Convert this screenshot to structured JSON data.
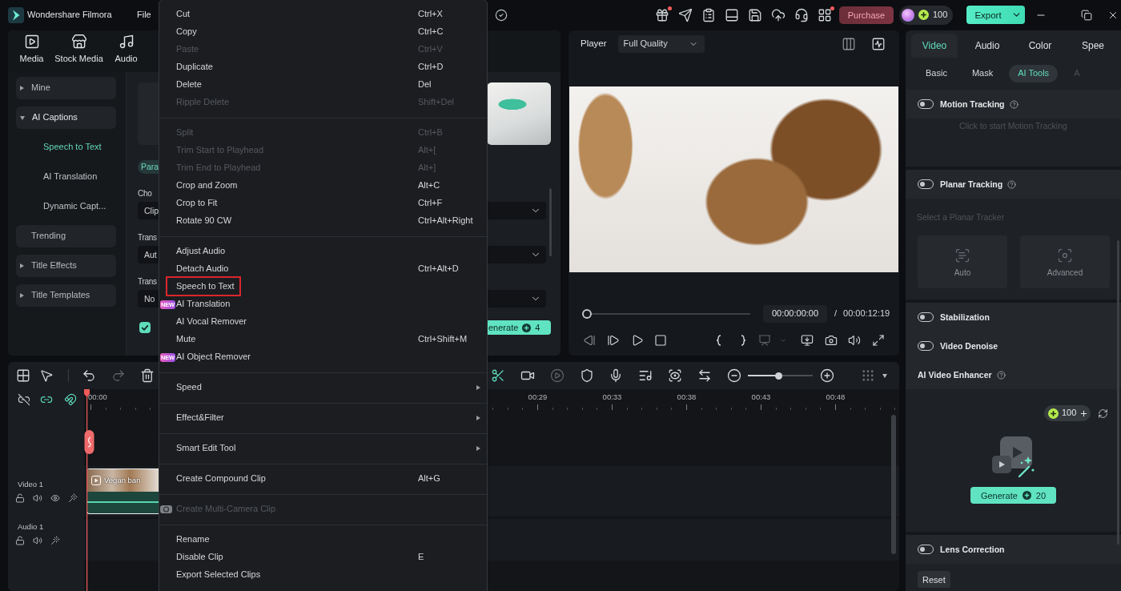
{
  "app_bar": {
    "title": "Wondershare Filmora",
    "menus": [
      "File"
    ],
    "tools": [
      {
        "kind": "gift",
        "dot": true
      },
      {
        "kind": "send",
        "dot": false
      },
      {
        "kind": "tasks",
        "dot": false
      },
      {
        "kind": "screen",
        "dot": false
      },
      {
        "kind": "save",
        "dot": false
      },
      {
        "kind": "cloud",
        "dot": false
      },
      {
        "kind": "support",
        "dot": false
      },
      {
        "kind": "apps",
        "dot": true
      }
    ],
    "purchase": "Purchase",
    "credits": "100",
    "export": "Export"
  },
  "library": {
    "tabs": [
      {
        "label": "Media",
        "kind": "media"
      },
      {
        "label": "Stock Media",
        "kind": "stock"
      },
      {
        "label": "Audio",
        "kind": "audio"
      }
    ],
    "tree": [
      {
        "label": "Mine",
        "kind": "folder",
        "expanded": false
      },
      {
        "label": "AI Captions",
        "kind": "folder",
        "expanded": true,
        "children": [
          {
            "label": "Speech to Text",
            "selected": true
          },
          {
            "label": "AI Translation",
            "selected": false
          },
          {
            "label": "Dynamic Capt...",
            "selected": false
          }
        ]
      },
      {
        "label": "Trending",
        "kind": "plain"
      },
      {
        "label": "Title Effects",
        "kind": "folder",
        "expanded": false
      },
      {
        "label": "Title Templates",
        "kind": "folder",
        "expanded": false
      }
    ]
  },
  "captions_panel": {
    "mode_tab": "Para",
    "fields": [
      {
        "label": "Cho",
        "value": "Clip"
      },
      {
        "label": "Trans",
        "value": "Aut"
      },
      {
        "label": "Trans",
        "value": "No"
      }
    ],
    "checked": true,
    "generate": {
      "label": "enerate",
      "cost": "4"
    }
  },
  "context_menu": {
    "sections": [
      {
        "items": [
          {
            "label": "Cut",
            "shortcut": "Ctrl+X",
            "kind": "command",
            "disabled": false,
            "highlighted": false
          },
          {
            "label": "Copy",
            "shortcut": "Ctrl+C",
            "kind": "command",
            "disabled": false,
            "highlighted": false
          },
          {
            "label": "Paste",
            "shortcut": "Ctrl+V",
            "kind": "command",
            "disabled": true,
            "highlighted": false
          },
          {
            "label": "Duplicate",
            "shortcut": "Ctrl+D",
            "kind": "command",
            "disabled": false,
            "highlighted": false
          },
          {
            "label": "Delete",
            "shortcut": "Del",
            "kind": "command",
            "disabled": false,
            "highlighted": false
          },
          {
            "label": "Ripple Delete",
            "shortcut": "Shift+Del",
            "kind": "command",
            "disabled": true,
            "highlighted": false
          }
        ]
      },
      {
        "items": [
          {
            "label": "Split",
            "shortcut": "Ctrl+B",
            "kind": "command",
            "disabled": true,
            "highlighted": false
          },
          {
            "label": "Trim Start to Playhead",
            "shortcut": "Alt+[",
            "kind": "command",
            "disabled": true,
            "highlighted": false
          },
          {
            "label": "Trim End to Playhead",
            "shortcut": "Alt+]",
            "kind": "command",
            "disabled": true,
            "highlighted": false
          },
          {
            "label": "Crop and Zoom",
            "shortcut": "Alt+C",
            "kind": "command",
            "disabled": false,
            "highlighted": false
          },
          {
            "label": "Crop to Fit",
            "shortcut": "Ctrl+F",
            "kind": "command",
            "disabled": false,
            "highlighted": false
          },
          {
            "label": "Rotate 90 CW",
            "shortcut": "Ctrl+Alt+Right",
            "kind": "command",
            "disabled": false,
            "highlighted": false
          }
        ]
      },
      {
        "items": [
          {
            "label": "Adjust Audio",
            "kind": "command",
            "disabled": false,
            "highlighted": false
          },
          {
            "label": "Detach Audio",
            "shortcut": "Ctrl+Alt+D",
            "kind": "command",
            "disabled": false,
            "highlighted": false
          },
          {
            "label": "Speech to Text",
            "kind": "command",
            "disabled": false,
            "highlighted": true
          },
          {
            "label": "AI Translation",
            "badge": "NEW",
            "kind": "command",
            "disabled": false,
            "highlighted": false
          },
          {
            "label": "AI Vocal Remover",
            "kind": "command",
            "disabled": false,
            "highlighted": false
          },
          {
            "label": "Mute",
            "shortcut": "Ctrl+Shift+M",
            "kind": "command",
            "disabled": false,
            "highlighted": false
          },
          {
            "label": "AI Object Remover",
            "badge": "NEW",
            "kind": "command",
            "disabled": false,
            "highlighted": false
          }
        ]
      },
      {
        "items": [
          {
            "label": "Speed",
            "kind": "submenu",
            "disabled": false,
            "highlighted": false
          }
        ]
      },
      {
        "items": [
          {
            "label": "Effect&Filter",
            "kind": "submenu",
            "disabled": false,
            "highlighted": false
          }
        ]
      },
      {
        "items": [
          {
            "label": "Smart Edit Tool",
            "kind": "submenu",
            "disabled": false,
            "highlighted": false
          }
        ]
      },
      {
        "items": [
          {
            "label": "Create Compound Clip",
            "shortcut": "Alt+G",
            "kind": "command",
            "disabled": false,
            "highlighted": false
          }
        ]
      },
      {
        "items": [
          {
            "label": "Create Multi-Camera Clip",
            "kind": "camera",
            "disabled": true,
            "highlighted": false
          }
        ]
      },
      {
        "items": [
          {
            "label": "Rename",
            "kind": "command",
            "disabled": false,
            "highlighted": false
          },
          {
            "label": "Disable Clip",
            "shortcut": "E",
            "kind": "command",
            "disabled": false,
            "highlighted": false
          },
          {
            "label": "Export Selected Clips",
            "kind": "command",
            "disabled": false,
            "highlighted": false
          }
        ]
      }
    ]
  },
  "player": {
    "label": "Player",
    "quality": "Full Quality",
    "progress": {
      "level": 0.03
    },
    "current_time": "00:00:00:00",
    "separator": "/",
    "duration": "00:00:12:19"
  },
  "inspector": {
    "tabs": [
      {
        "label": "Video",
        "selected": true
      },
      {
        "label": "Audio",
        "selected": false
      },
      {
        "label": "Color",
        "selected": false
      },
      {
        "label": "Spee",
        "selected": false
      }
    ],
    "subtabs": [
      {
        "label": "Basic",
        "selected": false,
        "disabled": false
      },
      {
        "label": "Mask",
        "selected": false,
        "disabled": false
      },
      {
        "label": "AI Tools",
        "selected": true,
        "disabled": false
      },
      {
        "label": "A",
        "selected": false,
        "disabled": true
      }
    ],
    "sections": [
      {
        "rows": [
          {
            "kind": "toggle",
            "label": "Motion Tracking",
            "on": false,
            "help": true
          }
        ],
        "empty_message": "Click to start Motion Tracking"
      },
      {
        "rows": [
          {
            "kind": "toggle",
            "label": "Planar Tracking",
            "on": false,
            "help": true
          }
        ],
        "caption": "Select a Planar Tracker",
        "options": [
          {
            "label": "Auto",
            "kind": "auto",
            "disabled": true
          },
          {
            "label": "Advanced",
            "kind": "advanced",
            "disabled": true
          }
        ]
      },
      {
        "rows": [
          {
            "kind": "toggle",
            "label": "Stabilization",
            "on": false,
            "help": false
          },
          {
            "kind": "toggle",
            "label": "Video Denoise",
            "on": false,
            "help": false
          },
          {
            "kind": "heading",
            "label": "AI Video Enhancer",
            "help": true
          }
        ],
        "enhancer": {
          "credits": "100",
          "button": "Generate",
          "cost": "20"
        }
      },
      {
        "rows": [
          {
            "kind": "toggle",
            "label": "Lens Correction",
            "on": false,
            "help": false
          }
        ],
        "button": "Reset"
      }
    ]
  },
  "timeline": {
    "zoom": {
      "level": 0.47
    },
    "ruler": [
      "00:00",
      "00:29",
      "00:33",
      "00:38",
      "00:43",
      "00:48"
    ],
    "tracks": [
      {
        "label": "Video 1",
        "kind": "video",
        "clips": [
          {
            "title": "Vegan ban",
            "selected": true
          }
        ]
      },
      {
        "label": "Audio 1",
        "kind": "audio"
      }
    ]
  }
}
